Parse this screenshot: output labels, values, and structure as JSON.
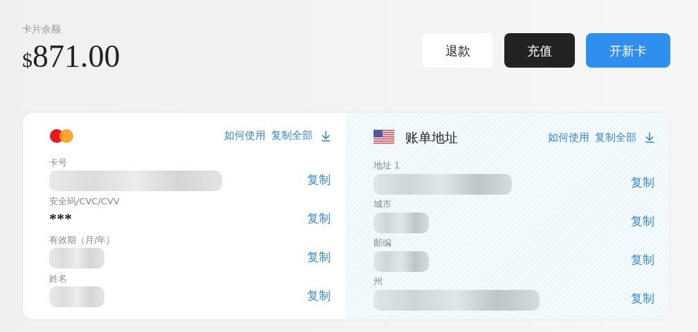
{
  "balance": {
    "label": "卡片余额",
    "currency": "$",
    "amount": "871.00"
  },
  "actions": [
    {
      "label": "退款",
      "kind": "light"
    },
    {
      "label": "充值",
      "kind": "dark"
    },
    {
      "label": "开新卡",
      "kind": "primary"
    }
  ],
  "card_panel": {
    "links": [
      "如何使用",
      "复制全部"
    ],
    "fields": [
      {
        "label": "卡号",
        "kind": "redacted",
        "copy": "复制"
      },
      {
        "label": "安全码/CVC/CVV",
        "kind": "text",
        "value": "***",
        "copy": "复制"
      },
      {
        "label": "有效期（月/年）",
        "kind": "redacted",
        "copy": "复制"
      },
      {
        "label": "姓名",
        "kind": "redacted",
        "copy": "复制"
      }
    ]
  },
  "billing_panel": {
    "title": "账单地址",
    "links": [
      "如何使用",
      "复制全部"
    ],
    "fields": [
      {
        "label": "地址 1",
        "kind": "redacted",
        "copy": "复制"
      },
      {
        "label": "城市",
        "kind": "redacted",
        "copy": "复制"
      },
      {
        "label": "邮编",
        "kind": "redacted",
        "copy": "复制"
      },
      {
        "label": "州",
        "kind": "redacted",
        "copy": "复制"
      }
    ]
  }
}
